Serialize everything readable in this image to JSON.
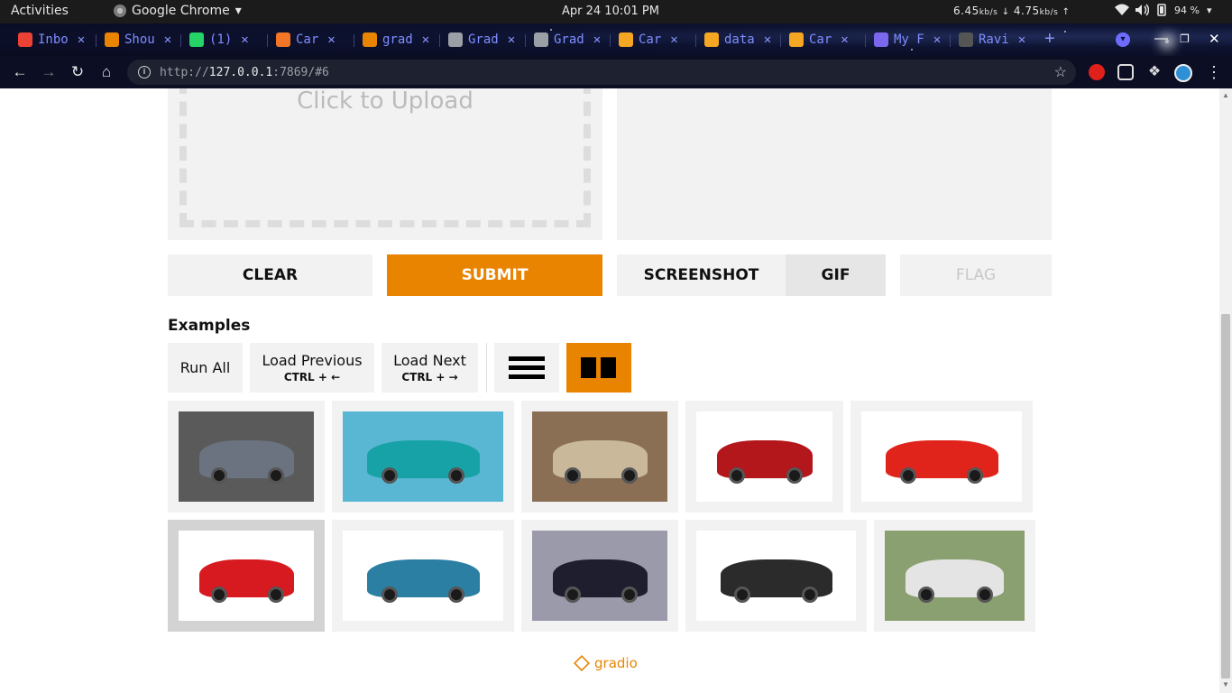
{
  "topbar": {
    "activities": "Activities",
    "app_name": "Google Chrome",
    "clock": "Apr 24 10:01 PM",
    "net_down": "6.45",
    "net_up": "4.75",
    "net_unit": "kb/s",
    "battery": "94 %"
  },
  "tabs": [
    {
      "label": "Inbo",
      "icon": "gmail-icon",
      "color": "#ea4335"
    },
    {
      "label": "Shou",
      "icon": "shop-icon",
      "color": "#e98400"
    },
    {
      "label": "(1)",
      "icon": "whatsapp-icon",
      "color": "#25d366"
    },
    {
      "label": "Car",
      "icon": "jupyter-icon",
      "color": "#f37626"
    },
    {
      "label": "grad",
      "icon": "hourglass-icon",
      "color": "#e98400"
    },
    {
      "label": "Grad",
      "icon": "globe-icon",
      "color": "#9aa0a6"
    },
    {
      "label": "Grad",
      "icon": "globe-icon",
      "color": "#9aa0a6"
    },
    {
      "label": "Car",
      "icon": "book-icon",
      "color": "#f5a623"
    },
    {
      "label": "data",
      "icon": "book-icon",
      "color": "#f5a623"
    },
    {
      "label": "Car",
      "icon": "book-icon",
      "color": "#f5a623"
    },
    {
      "label": "My F",
      "icon": "docs-icon",
      "color": "#7b68ee"
    },
    {
      "label": "Ravi",
      "icon": "github-icon",
      "color": "#555555"
    }
  ],
  "address": {
    "scheme": "http://",
    "host": "127.0.0.1",
    "path": ":7869/#6"
  },
  "upload": {
    "label": "Click to Upload"
  },
  "buttons": {
    "clear": "CLEAR",
    "submit": "SUBMIT",
    "screenshot": "SCREENSHOT",
    "gif": "GIF",
    "flag": "FLAG"
  },
  "examples": {
    "title": "Examples",
    "run_all": "Run All",
    "load_previous": "Load Previous",
    "load_previous_hint": "CTRL + ←",
    "load_next": "Load Next",
    "load_next_hint": "CTRL + →",
    "items": [
      {
        "name": "grey sedan",
        "color": "#6b7280",
        "bg": "#5a5a5a"
      },
      {
        "name": "teal supercar",
        "color": "#17a2a8",
        "bg": "#5ab7d4"
      },
      {
        "name": "champagne sedan",
        "color": "#c9b99a",
        "bg": "#8a6f55"
      },
      {
        "name": "red suv",
        "color": "#b3161b",
        "bg": "#ffffff"
      },
      {
        "name": "red compact suv",
        "color": "#e1241b",
        "bg": "#ffffff"
      },
      {
        "name": "red hatchback",
        "color": "#d71920",
        "bg": "#ffffff",
        "selected": true
      },
      {
        "name": "blue compact suv",
        "color": "#2a7fa3",
        "bg": "#ffffff"
      },
      {
        "name": "black limousine",
        "color": "#1e1e2e",
        "bg": "#9a9aaa"
      },
      {
        "name": "black suv",
        "color": "#2b2b2b",
        "bg": "#ffffff"
      },
      {
        "name": "white sedan",
        "color": "#e4e4e4",
        "bg": "#8aa070"
      }
    ]
  },
  "footer": {
    "brand": "gradio"
  },
  "colors": {
    "accent": "#e98400",
    "panel": "#f2f2f2"
  }
}
